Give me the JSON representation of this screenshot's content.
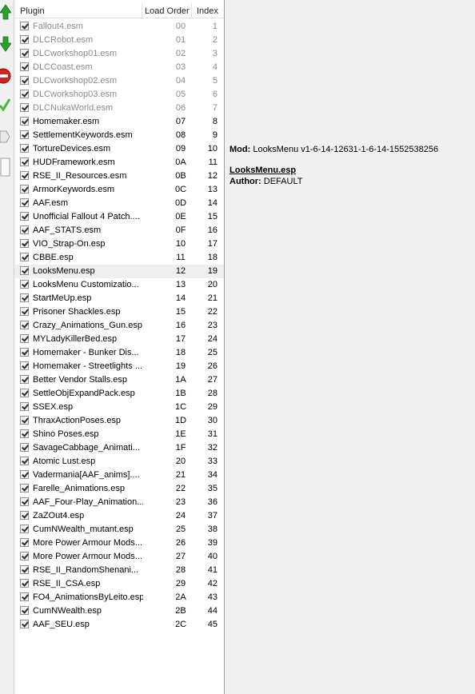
{
  "columns": {
    "plugin": "Plugin",
    "load_order": "Load Order",
    "index": "Index"
  },
  "toolbar": {
    "icons": [
      "arrow-up-icon",
      "arrow-down-icon",
      "forbidden-icon",
      "checkmark-icon",
      "tag-icon",
      "page-icon"
    ]
  },
  "plugins": [
    {
      "name": "Fallout4.esm",
      "order": "00",
      "index": "1",
      "master": true
    },
    {
      "name": "DLCRobot.esm",
      "order": "01",
      "index": "2",
      "master": true
    },
    {
      "name": "DLCworkshop01.esm",
      "order": "02",
      "index": "3",
      "master": true
    },
    {
      "name": "DLCCoast.esm",
      "order": "03",
      "index": "4",
      "master": true
    },
    {
      "name": "DLCworkshop02.esm",
      "order": "04",
      "index": "5",
      "master": true
    },
    {
      "name": "DLCworkshop03.esm",
      "order": "05",
      "index": "6",
      "master": true
    },
    {
      "name": "DLCNukaWorld.esm",
      "order": "06",
      "index": "7",
      "master": true
    },
    {
      "name": "Homemaker.esm",
      "order": "07",
      "index": "8"
    },
    {
      "name": "SettlementKeywords.esm",
      "order": "08",
      "index": "9"
    },
    {
      "name": "TortureDevices.esm",
      "order": "09",
      "index": "10"
    },
    {
      "name": "HUDFramework.esm",
      "order": "0A",
      "index": "11"
    },
    {
      "name": "RSE_II_Resources.esm",
      "order": "0B",
      "index": "12"
    },
    {
      "name": "ArmorKeywords.esm",
      "order": "0C",
      "index": "13"
    },
    {
      "name": "AAF.esm",
      "order": "0D",
      "index": "14"
    },
    {
      "name": "Unofficial Fallout 4 Patch....",
      "order": "0E",
      "index": "15"
    },
    {
      "name": "AAF_STATS.esm",
      "order": "0F",
      "index": "16"
    },
    {
      "name": "VIO_Strap-On.esp",
      "order": "10",
      "index": "17"
    },
    {
      "name": "CBBE.esp",
      "order": "11",
      "index": "18"
    },
    {
      "name": "LooksMenu.esp",
      "order": "12",
      "index": "19",
      "selected": true
    },
    {
      "name": "LooksMenu Customizatio...",
      "order": "13",
      "index": "20"
    },
    {
      "name": "StartMeUp.esp",
      "order": "14",
      "index": "21"
    },
    {
      "name": "Prisoner Shackles.esp",
      "order": "15",
      "index": "22"
    },
    {
      "name": "Crazy_Animations_Gun.esp",
      "order": "16",
      "index": "23"
    },
    {
      "name": "MYLadyKillerBed.esp",
      "order": "17",
      "index": "24"
    },
    {
      "name": "Homemaker - Bunker Dis...",
      "order": "18",
      "index": "25"
    },
    {
      "name": "Homemaker - Streetlights ...",
      "order": "19",
      "index": "26"
    },
    {
      "name": "Better Vendor Stalls.esp",
      "order": "1A",
      "index": "27"
    },
    {
      "name": "SettleObjExpandPack.esp",
      "order": "1B",
      "index": "28"
    },
    {
      "name": "SSEX.esp",
      "order": "1C",
      "index": "29"
    },
    {
      "name": "ThraxActionPoses.esp",
      "order": "1D",
      "index": "30"
    },
    {
      "name": "Shino Poses.esp",
      "order": "1E",
      "index": "31"
    },
    {
      "name": "SavageCabbage_Animati...",
      "order": "1F",
      "index": "32"
    },
    {
      "name": "Atomic Lust.esp",
      "order": "20",
      "index": "33"
    },
    {
      "name": "Vadermania[AAF_anims]....",
      "order": "21",
      "index": "34"
    },
    {
      "name": "Farelle_Animations.esp",
      "order": "22",
      "index": "35"
    },
    {
      "name": "AAF_Four-Play_Animation...",
      "order": "23",
      "index": "36"
    },
    {
      "name": "ZaZOut4.esp",
      "order": "24",
      "index": "37"
    },
    {
      "name": "CumNWealth_mutant.esp",
      "order": "25",
      "index": "38"
    },
    {
      "name": "More Power Armour Mods...",
      "order": "26",
      "index": "39"
    },
    {
      "name": "More Power Armour Mods...",
      "order": "27",
      "index": "40"
    },
    {
      "name": "RSE_II_RandomShenani...",
      "order": "28",
      "index": "41"
    },
    {
      "name": "RSE_II_CSA.esp",
      "order": "29",
      "index": "42"
    },
    {
      "name": "FO4_AnimationsByLeito.esp",
      "order": "2A",
      "index": "43"
    },
    {
      "name": "CumNWealth.esp",
      "order": "2B",
      "index": "44"
    },
    {
      "name": "AAF_SEU.esp",
      "order": "2C",
      "index": "45"
    }
  ],
  "info": {
    "mod_label": "Mod:",
    "mod_value": "LooksMenu v1-6-14-12631-1-6-14-1552538256",
    "file": "LooksMenu.esp",
    "author_label": "Author:",
    "author_value": "DEFAULT"
  },
  "colors": {
    "master_text": "#8a8a8a",
    "selected_row": "#efefef"
  }
}
